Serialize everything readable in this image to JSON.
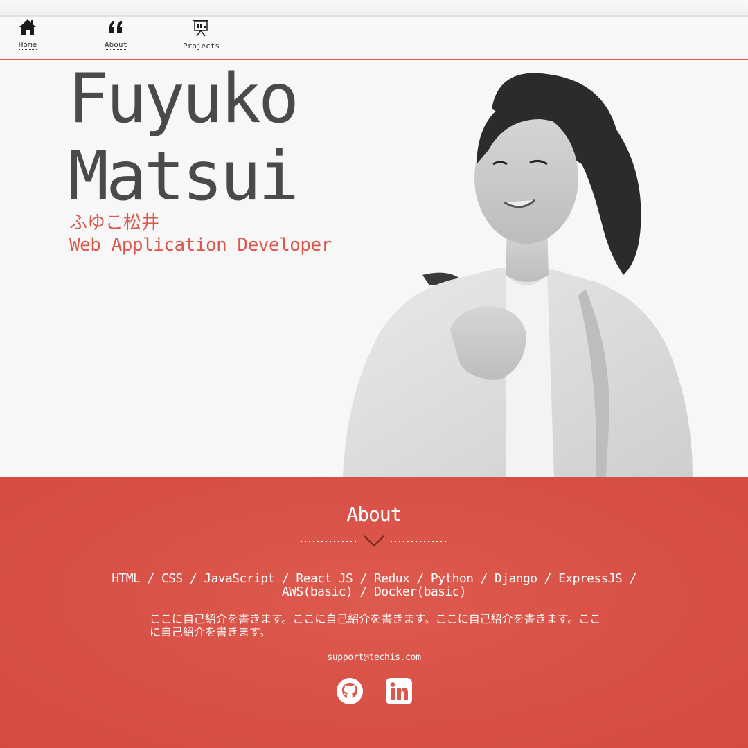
{
  "nav": {
    "items": [
      {
        "label": "Home",
        "icon": "home-icon"
      },
      {
        "label": "About",
        "icon": "quote-icon"
      },
      {
        "label": "Projects",
        "icon": "presentation-icon"
      }
    ]
  },
  "hero": {
    "first_name": "Fuyuko",
    "last_name": "Matsui",
    "kana_name": "ふゆこ松井",
    "role": "Web Application Developer",
    "portrait_icon": "portrait-photo"
  },
  "about": {
    "heading": "About",
    "skills_line1": "HTML / CSS / JavaScript / React JS / Redux / Python / Django / ExpressJS /",
    "skills_line2": "AWS(basic) / Docker(basic)",
    "bio": "ここに自己紹介を書きます。ここに自己紹介を書きます。ここに自己紹介を書きます。ここに自己紹介を書きます。",
    "email": "support@techis.com",
    "social": [
      {
        "icon": "github-icon"
      },
      {
        "icon": "linkedin-icon"
      }
    ]
  },
  "colors": {
    "accent": "#d9574b",
    "text_dark": "#4a4a4a",
    "background": "#f7f7f7"
  }
}
